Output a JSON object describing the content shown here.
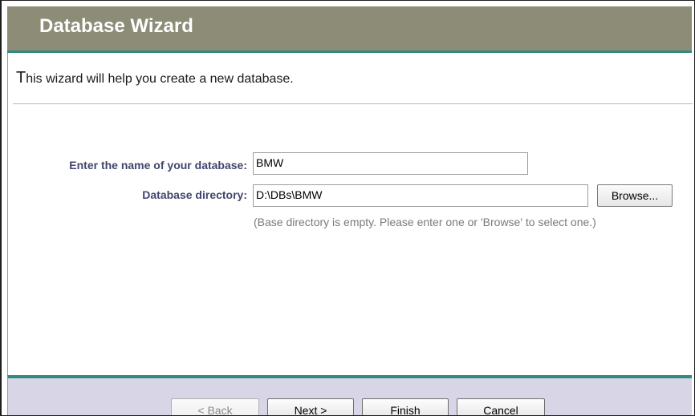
{
  "window": {
    "title": "Database Wizard"
  },
  "intro": {
    "first_letter": "T",
    "rest": "his wizard will help you create a new database."
  },
  "form": {
    "name_label": "Enter the name of your database:",
    "name_value": "BMW",
    "dir_label": "Database directory:",
    "dir_value": "D:\\DBs\\BMW",
    "browse_label": "Browse...",
    "hint": "(Base directory is empty. Please enter one or 'Browse' to select one.)"
  },
  "footer": {
    "back_label": "< Back",
    "next_label": "Next >",
    "finish_label": "Finish",
    "cancel_label": "Cancel",
    "back_disabled": true
  },
  "colors": {
    "title_bar": "#8d8c77",
    "accent_line": "#2f8a80",
    "label_text": "#40466e",
    "footer_bg": "#d8d6e6"
  }
}
